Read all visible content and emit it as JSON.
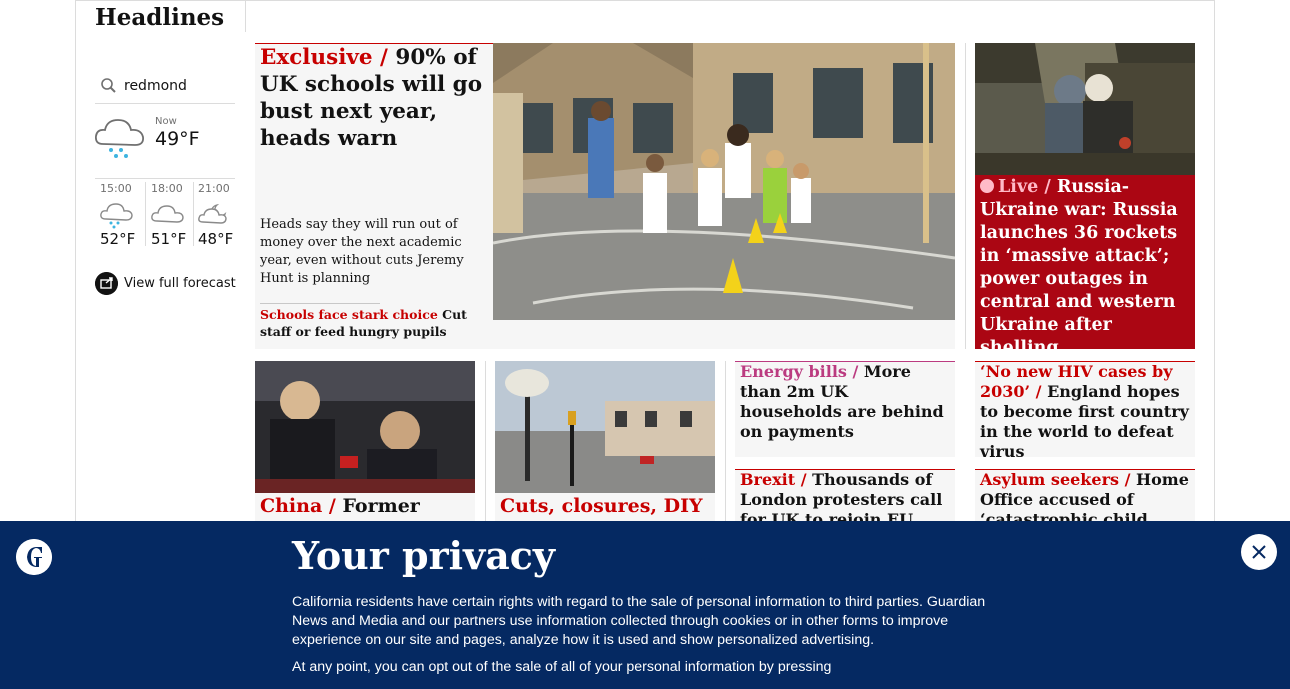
{
  "section": {
    "title": "Headlines"
  },
  "weather": {
    "location": "redmond",
    "now_label": "Now",
    "now_temp": "49°F",
    "forecast": [
      {
        "time": "15:00",
        "temp": "52°F",
        "icon": "rain-cloud-icon"
      },
      {
        "time": "18:00",
        "temp": "51°F",
        "icon": "cloud-icon"
      },
      {
        "time": "21:00",
        "temp": "48°F",
        "icon": "moon-cloud-icon"
      }
    ],
    "view_full": "View full forecast"
  },
  "main_story": {
    "kicker": "Exclusive / ",
    "headline": "90% of UK schools will go bust next year, heads warn",
    "standfirst": "Heads say they will run out of money over the next academic year, even without cuts Jeremy Hunt is planning",
    "sublink_kicker": "Schools face stark choice",
    "sublink_text": " Cut staff or feed hungry pupils"
  },
  "live_story": {
    "kicker": "Live / ",
    "headline": "Russia-Ukraine war: Russia launches 36 rockets in ‘massive attack’; power outages in central and western Ukraine after shelling"
  },
  "row2": [
    {
      "kicker": "China / ",
      "headline": "Former"
    },
    {
      "kicker": "Cuts, closures, DIY",
      "headline": ""
    },
    {
      "kicker": "Energy bills / ",
      "headline": "More than 2m UK households are behind on payments"
    },
    {
      "kicker": "‘No new HIV cases by 2030’ / ",
      "headline": "England hopes to become first country in the world to defeat virus"
    },
    {
      "kicker": "Brexit / ",
      "headline": "Thousands of London protesters call for UK to rejoin EU"
    },
    {
      "kicker": "Asylum seekers / ",
      "headline": "Home Office accused of ‘catastrophic child"
    }
  ],
  "privacy": {
    "title": "Your privacy",
    "paragraph1": "California residents have certain rights with regard to the sale of personal information to third parties. Guardian News and Media and our partners use information collected through cookies or in other forms to improve experience on our site and pages, analyze how it is used and show personalized advertising.",
    "paragraph2": "At any point, you can opt out of the sale of all of your personal information by pressing"
  },
  "colors": {
    "red": "#c70000",
    "pink": "#bb3b80",
    "live_bg": "#ab0613",
    "banner": "#052962"
  }
}
